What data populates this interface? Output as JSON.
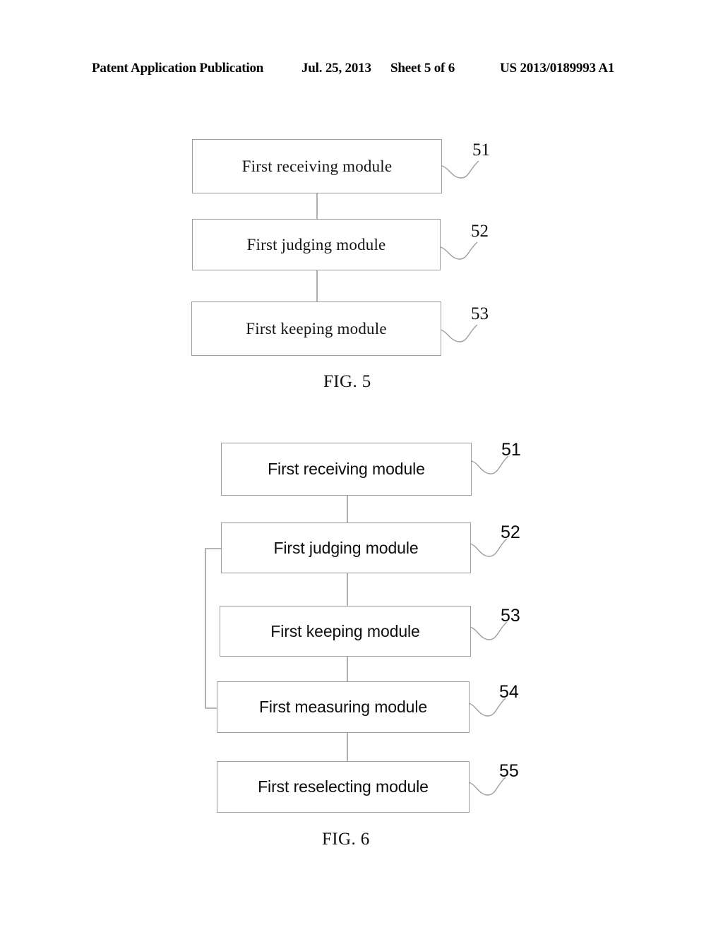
{
  "header": {
    "publication": "Patent Application Publication",
    "date": "Jul. 25, 2013",
    "sheet": "Sheet 5 of 6",
    "patent_number": "US 2013/0189993 A1"
  },
  "colors": {
    "line": "#9d9d9d",
    "text": "#000000",
    "background": "#ffffff"
  },
  "figures": [
    {
      "id": "fig-5",
      "caption": "FIG. 5",
      "font_style": "serif",
      "boxes": [
        {
          "label": "First receiving module",
          "ref": "51"
        },
        {
          "label": "First judging module",
          "ref": "52"
        },
        {
          "label": "First keeping module",
          "ref": "53"
        }
      ],
      "connections": [
        {
          "from": "51",
          "to": "52",
          "kind": "vertical"
        },
        {
          "from": "52",
          "to": "53",
          "kind": "vertical"
        }
      ]
    },
    {
      "id": "fig-6",
      "caption": "FIG. 6",
      "font_style": "sans-serif",
      "boxes": [
        {
          "label": "First receiving module",
          "ref": "51"
        },
        {
          "label": "First judging module",
          "ref": "52"
        },
        {
          "label": "First keeping module",
          "ref": "53"
        },
        {
          "label": "First measuring module",
          "ref": "54"
        },
        {
          "label": "First reselecting module",
          "ref": "55"
        }
      ],
      "connections": [
        {
          "from": "51",
          "to": "52",
          "kind": "vertical"
        },
        {
          "from": "52",
          "to": "53",
          "kind": "vertical"
        },
        {
          "from": "53",
          "to": "54",
          "kind": "vertical"
        },
        {
          "from": "54",
          "to": "55",
          "kind": "vertical"
        },
        {
          "from": "54",
          "to": "52",
          "kind": "feedback-left"
        }
      ]
    }
  ]
}
